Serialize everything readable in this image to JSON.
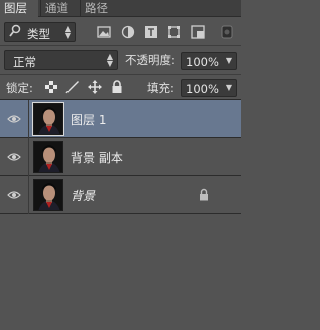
{
  "tabs": [
    {
      "label": "图层",
      "active": true
    },
    {
      "label": "通道",
      "active": false
    },
    {
      "label": "路径",
      "active": false
    }
  ],
  "filter": {
    "kind_label": "类型",
    "icons": [
      "image-filter-icon",
      "adjustment-filter-icon",
      "type-filter-icon",
      "shape-filter-icon",
      "smart-object-filter-icon",
      "filter-toggle-icon"
    ]
  },
  "blend": {
    "mode": "正常",
    "opacity_label": "不透明度:",
    "opacity_value": "100%"
  },
  "lock": {
    "label": "锁定:",
    "icons": [
      "lock-transparent-icon",
      "lock-image-icon",
      "lock-position-icon",
      "lock-all-icon"
    ],
    "fill_label": "填充:",
    "fill_value": "100%"
  },
  "layers": [
    {
      "name": "图层 1",
      "selected": true,
      "locked": false,
      "italic": false
    },
    {
      "name": "背景 副本",
      "selected": false,
      "locked": false,
      "italic": false
    },
    {
      "name": "背景",
      "selected": false,
      "locked": true,
      "italic": true
    }
  ],
  "colors": {
    "panel": "#535353",
    "selected_row": "#687890",
    "tabbar": "#3f3f3f"
  }
}
